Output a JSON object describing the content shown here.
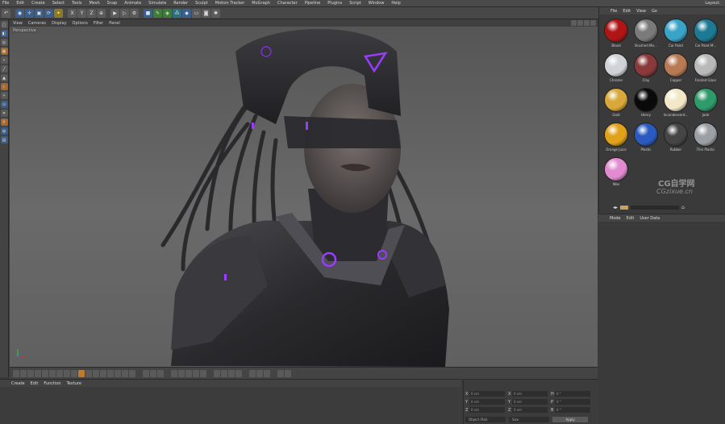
{
  "menu": [
    "File",
    "Edit",
    "Create",
    "Select",
    "Tools",
    "Mesh",
    "Snap",
    "Animate",
    "Simulate",
    "Render",
    "Sculpt",
    "Motion Tracker",
    "MoGraph",
    "Character",
    "Pipeline",
    "Plugins",
    "Script",
    "Window",
    "Help"
  ],
  "layout_label": "Layout:",
  "viewport": {
    "menu": [
      "View",
      "Cameras",
      "Display",
      "Options",
      "Filter",
      "Panel"
    ],
    "view_name": "Perspective"
  },
  "material_manager": {
    "menu": [
      "Create",
      "Edit",
      "Function",
      "Texture"
    ]
  },
  "coordinates": {
    "rows": [
      [
        {
          "axis": "X",
          "value": "0 cm"
        },
        {
          "axis": "X",
          "value": "0 cm"
        },
        {
          "axis": "H",
          "value": "0 °"
        }
      ],
      [
        {
          "axis": "Y",
          "value": "0 cm"
        },
        {
          "axis": "Y",
          "value": "0 cm"
        },
        {
          "axis": "P",
          "value": "0 °"
        }
      ],
      [
        {
          "axis": "Z",
          "value": "0 cm"
        },
        {
          "axis": "Z",
          "value": "0 cm"
        },
        {
          "axis": "B",
          "value": "0 °"
        }
      ]
    ],
    "mode_left": "Object (Rel)",
    "mode_mid": "Size",
    "apply": "Apply"
  },
  "content_browser": {
    "menu": [
      "File",
      "Edit",
      "View",
      "Go"
    ],
    "materials": [
      {
        "label": "Blood",
        "color": "#b01515"
      },
      {
        "label": "Brushed Me...",
        "color": "#7a7a7a"
      },
      {
        "label": "Car Paint",
        "color": "#3aa3c8"
      },
      {
        "label": "Car Paint M...",
        "color": "#1d7a95"
      },
      {
        "label": "Chrome",
        "color": "#cfd3d8"
      },
      {
        "label": "Clay",
        "color": "#8a3a3a"
      },
      {
        "label": "Copper",
        "color": "#b87a55"
      },
      {
        "label": "Frosted Glass",
        "color": "#b9b9b9"
      },
      {
        "label": "Gold",
        "color": "#d8a83a"
      },
      {
        "label": "Henry",
        "color": "#0a0a0a"
      },
      {
        "label": "Incandescent...",
        "color": "#f2e8c8"
      },
      {
        "label": "Jade",
        "color": "#2f9a6a"
      },
      {
        "label": "Orange Juice",
        "color": "#e0a21a"
      },
      {
        "label": "Plastic",
        "color": "#2a5ac0"
      },
      {
        "label": "Rubber",
        "color": "#454545"
      },
      {
        "label": "Thin Plastic",
        "color": "#9aa0a6"
      },
      {
        "label": "Wax",
        "color": "#e28bd0"
      }
    ]
  },
  "attributes": {
    "menu": [
      "Mode",
      "Edit",
      "User Data"
    ]
  },
  "watermark": {
    "line1": "CG自学网",
    "line2": "CGzixue.cn"
  },
  "accent": "#9a3cff"
}
